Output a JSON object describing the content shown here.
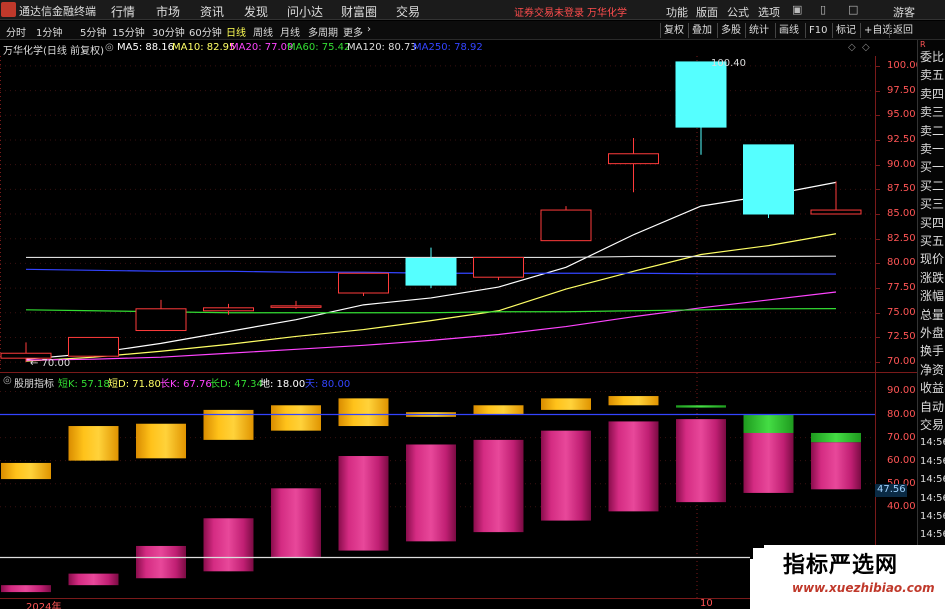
{
  "topbar": {
    "app_name": "通达信金融终端",
    "menu": [
      "行情",
      "市场",
      "资讯",
      "发现",
      "问小达",
      "财富圈",
      "交易"
    ],
    "notice": "证券交易未登录",
    "stock_name": "万华化学",
    "right_menu": [
      "功能",
      "版面",
      "公式",
      "选项"
    ],
    "guest": "游客"
  },
  "periodbar": {
    "tabs": [
      "分时",
      "1分钟",
      "5分钟",
      "15分钟",
      "30分钟",
      "60分钟",
      "日线",
      "周线",
      "月线",
      "多周期",
      "更多"
    ],
    "active_tab": "日线",
    "toolbar": [
      "复权",
      "叠加",
      "多股",
      "统计",
      "画线",
      "F10",
      "标记",
      "+自选",
      "返回"
    ]
  },
  "main_info": {
    "title": "万华化学(日线 前复权)",
    "ma5": "MA5: 88.16",
    "ma10": "MA10: 82.95",
    "ma20": "MA20: 77.09",
    "ma60": "MA60: 75.42",
    "ma120": "MA120: 80.73",
    "ma250": "MA250: 78.92",
    "high_label": "100.40",
    "low_label": "70.00"
  },
  "indicator_info": {
    "name": "股朋指标",
    "short_k": "短K: 57.18",
    "short_d": "短D: 71.80",
    "long_k": "长K: 67.76",
    "long_d": "长D: 47.34",
    "ground": "地: 18.00",
    "sky": "天: 80.00",
    "current_value": "47.56"
  },
  "sidebar": {
    "r_label": "R",
    "items": [
      "委比",
      "卖五",
      "卖四",
      "卖三",
      "卖二",
      "卖一",
      "买一",
      "买二",
      "买三",
      "买四",
      "买五",
      "现价",
      "涨跌",
      "涨幅",
      "总量",
      "外盘",
      "换手",
      "净资",
      "收益",
      "自动",
      "交易",
      "14:56",
      "14:56",
      "14:56",
      "14:56",
      "14:56",
      "14:56",
      "14:56",
      "14:56",
      "14:56"
    ]
  },
  "date_labels": {
    "year": "2024年",
    "day": "10"
  },
  "watermark": {
    "title": "指标严选网",
    "url": "www.xuezhibiao.com"
  },
  "colors": {
    "up_candle": "#ff3b3b",
    "down_candle": "#55ffff",
    "ma5": "#ffffff",
    "ma10": "#ffff66",
    "ma20": "#ff44ff",
    "ma60": "#33dd33",
    "ma120": "#dddddd",
    "ma250": "#3344ff"
  },
  "chart_data": [
    {
      "type": "candlestick",
      "title": "万华化学(日线 前复权)",
      "ylim": [
        69,
        101
      ],
      "yticks": [
        70.0,
        72.5,
        75.0,
        77.5,
        80.0,
        82.5,
        85.0,
        87.5,
        90.0,
        92.5,
        95.0,
        97.5,
        100.0
      ],
      "candles": [
        {
          "o": 70.4,
          "c": 70.9,
          "h": 72.0,
          "l": 70.0
        },
        {
          "o": 70.6,
          "c": 72.5,
          "h": 72.5,
          "l": 70.6
        },
        {
          "o": 73.2,
          "c": 75.4,
          "h": 76.3,
          "l": 73.2
        },
        {
          "o": 75.2,
          "c": 75.5,
          "h": 75.9,
          "l": 74.8
        },
        {
          "o": 75.6,
          "c": 75.7,
          "h": 76.2,
          "l": 75.4
        },
        {
          "o": 77.0,
          "c": 79.0,
          "h": 79.0,
          "l": 76.7
        },
        {
          "o": 80.5,
          "c": 77.8,
          "h": 81.6,
          "l": 77.5
        },
        {
          "o": 78.6,
          "c": 80.6,
          "h": 80.6,
          "l": 78.3
        },
        {
          "o": 82.3,
          "c": 85.4,
          "h": 85.8,
          "l": 82.3
        },
        {
          "o": 90.1,
          "c": 91.1,
          "h": 92.7,
          "l": 87.2
        },
        {
          "o": 100.4,
          "c": 93.8,
          "h": 100.4,
          "l": 91.0
        },
        {
          "o": 92.0,
          "c": 85.0,
          "h": 92.0,
          "l": 84.6
        },
        {
          "o": 85.0,
          "c": 85.4,
          "h": 88.3,
          "l": 85.0
        }
      ],
      "series": [
        {
          "name": "MA5",
          "values": [
            70.3,
            70.9,
            71.9,
            73.1,
            74.3,
            75.8,
            76.5,
            77.6,
            79.6,
            82.9,
            85.8,
            86.9,
            88.2
          ]
        },
        {
          "name": "MA10",
          "values": [
            70.1,
            70.5,
            71.1,
            71.8,
            72.6,
            73.3,
            74.2,
            75.2,
            77.4,
            79.2,
            80.9,
            81.8,
            83.0
          ]
        },
        {
          "name": "MA20",
          "values": [
            70.2,
            70.3,
            70.5,
            70.9,
            71.3,
            71.7,
            72.2,
            72.8,
            73.6,
            74.6,
            75.5,
            76.3,
            77.1
          ]
        },
        {
          "name": "MA60",
          "values": [
            75.3,
            75.2,
            75.1,
            75.0,
            75.0,
            75.0,
            75.0,
            75.1,
            75.1,
            75.2,
            75.3,
            75.4,
            75.42
          ]
        },
        {
          "name": "MA120",
          "values": [
            80.6,
            80.6,
            80.6,
            80.6,
            80.6,
            80.6,
            80.6,
            80.6,
            80.6,
            80.7,
            80.7,
            80.7,
            80.73
          ]
        },
        {
          "name": "MA250",
          "values": [
            79.4,
            79.3,
            79.2,
            79.2,
            79.1,
            79.1,
            79.0,
            79.0,
            79.0,
            79.0,
            78.95,
            78.93,
            78.92
          ]
        }
      ]
    },
    {
      "type": "bar",
      "title": "股朋指标",
      "ylim": [
        0,
        98
      ],
      "yticks": [
        40,
        50,
        60,
        70,
        80,
        90
      ],
      "reference_lines": [
        {
          "name": "天",
          "value": 80
        },
        {
          "name": "地",
          "value": 18
        }
      ],
      "series": [
        {
          "name": "长区间",
          "ranges": [
            [
              3,
              6
            ],
            [
              6,
              11
            ],
            [
              9,
              23
            ],
            [
              12,
              35
            ],
            [
              18,
              48
            ],
            [
              21,
              62
            ],
            [
              25,
              67
            ],
            [
              29,
              69
            ],
            [
              34,
              73
            ],
            [
              38,
              77
            ],
            [
              42,
              78
            ],
            [
              46,
              76
            ],
            [
              47.56,
              68
            ]
          ]
        },
        {
          "name": "短区间",
          "ranges": [
            [
              52,
              59
            ],
            [
              60,
              75
            ],
            [
              61,
              76
            ],
            [
              69,
              82
            ],
            [
              73,
              84
            ],
            [
              75,
              87
            ],
            [
              79,
              81
            ],
            [
              80,
              84
            ],
            [
              82,
              87
            ],
            [
              84,
              88
            ],
            [
              83,
              84
            ],
            [
              72,
              80
            ],
            [
              68,
              72
            ]
          ]
        }
      ]
    }
  ]
}
